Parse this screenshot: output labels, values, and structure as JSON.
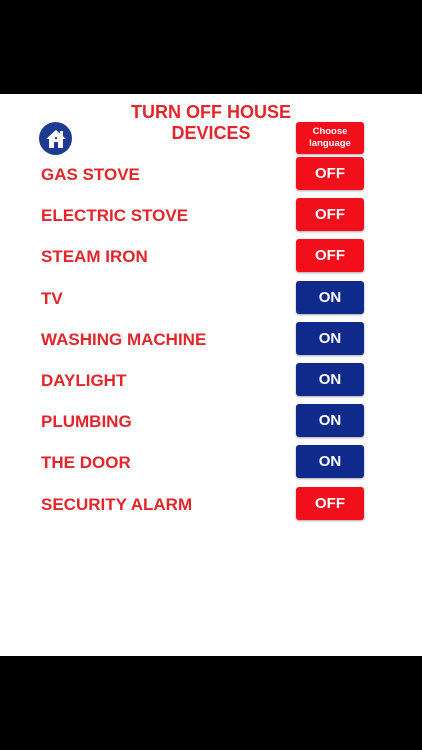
{
  "header": {
    "title": "TURN OFF HOUSE DEVICES",
    "language_button": "Choose language"
  },
  "devices": [
    {
      "label": "GAS STOVE",
      "state": "OFF"
    },
    {
      "label": "ELECTRIC STOVE",
      "state": "OFF"
    },
    {
      "label": "STEAM IRON",
      "state": "OFF"
    },
    {
      "label": "TV",
      "state": "ON"
    },
    {
      "label": "WASHING MACHINE",
      "state": "ON"
    },
    {
      "label": "DAYLIGHT",
      "state": "ON"
    },
    {
      "label": "PLUMBING",
      "state": "ON"
    },
    {
      "label": "THE DOOR",
      "state": "ON"
    },
    {
      "label": "SECURITY ALARM",
      "state": "OFF"
    }
  ],
  "colors": {
    "text_red": "#e3262b",
    "off_button": "#f20f1b",
    "on_button": "#0f2a8a",
    "home_button": "#1f3a93"
  }
}
